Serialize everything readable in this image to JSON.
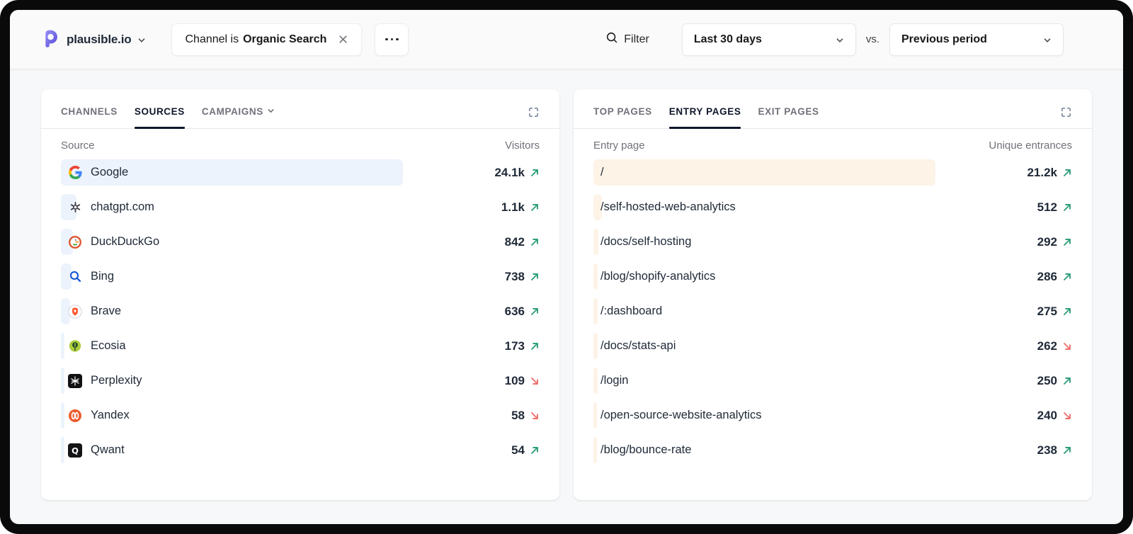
{
  "header": {
    "site_name": "plausible.io",
    "filter_chip": {
      "prefix": "Channel is",
      "value": "Organic Search"
    },
    "filter_label": "Filter",
    "date_range": "Last 30 days",
    "vs_label": "vs.",
    "comparison": "Previous period"
  },
  "colors": {
    "trend_up": "#2f9e7c",
    "trend_down": "#ef6f6a",
    "logo_accent": "#6e62ee",
    "active_tab": "#0f172a"
  },
  "sources_panel": {
    "tabs": [
      {
        "label": "CHANNELS",
        "active": false,
        "has_dropdown": false
      },
      {
        "label": "SOURCES",
        "active": true,
        "has_dropdown": false
      },
      {
        "label": "CAMPAIGNS",
        "active": false,
        "has_dropdown": true
      }
    ],
    "columns": {
      "label": "Source",
      "value": "Visitors"
    },
    "bar_color": "#edf3fc",
    "max_num": 24100,
    "rows": [
      {
        "icon": "google",
        "label": "Google",
        "value": "24.1k",
        "num": 24100,
        "trend": "up"
      },
      {
        "icon": "openai",
        "label": "chatgpt.com",
        "value": "1.1k",
        "num": 1100,
        "trend": "up"
      },
      {
        "icon": "duckduckgo",
        "label": "DuckDuckGo",
        "value": "842",
        "num": 842,
        "trend": "up"
      },
      {
        "icon": "bing",
        "label": "Bing",
        "value": "738",
        "num": 738,
        "trend": "up"
      },
      {
        "icon": "brave",
        "label": "Brave",
        "value": "636",
        "num": 636,
        "trend": "up"
      },
      {
        "icon": "ecosia",
        "label": "Ecosia",
        "value": "173",
        "num": 173,
        "trend": "up"
      },
      {
        "icon": "perplexity",
        "label": "Perplexity",
        "value": "109",
        "num": 109,
        "trend": "down"
      },
      {
        "icon": "yandex",
        "label": "Yandex",
        "value": "58",
        "num": 58,
        "trend": "down"
      },
      {
        "icon": "qwant",
        "label": "Qwant",
        "value": "54",
        "num": 54,
        "trend": "up"
      }
    ]
  },
  "pages_panel": {
    "tabs": [
      {
        "label": "TOP PAGES",
        "active": false,
        "has_dropdown": false
      },
      {
        "label": "ENTRY PAGES",
        "active": true,
        "has_dropdown": false
      },
      {
        "label": "EXIT PAGES",
        "active": false,
        "has_dropdown": false
      }
    ],
    "columns": {
      "label": "Entry page",
      "value": "Unique entrances"
    },
    "bar_color": "#fdf3e7",
    "max_num": 21200,
    "rows": [
      {
        "label": "/",
        "value": "21.2k",
        "num": 21200,
        "trend": "up"
      },
      {
        "label": "/self-hosted-web-analytics",
        "value": "512",
        "num": 512,
        "trend": "up"
      },
      {
        "label": "/docs/self-hosting",
        "value": "292",
        "num": 292,
        "trend": "up"
      },
      {
        "label": "/blog/shopify-analytics",
        "value": "286",
        "num": 286,
        "trend": "up"
      },
      {
        "label": "/:dashboard",
        "value": "275",
        "num": 275,
        "trend": "up"
      },
      {
        "label": "/docs/stats-api",
        "value": "262",
        "num": 262,
        "trend": "down"
      },
      {
        "label": "/login",
        "value": "250",
        "num": 250,
        "trend": "up"
      },
      {
        "label": "/open-source-website-analytics",
        "value": "240",
        "num": 240,
        "trend": "down"
      },
      {
        "label": "/blog/bounce-rate",
        "value": "238",
        "num": 238,
        "trend": "up"
      }
    ]
  },
  "icons": [
    "plausible-logo",
    "chevron-down",
    "search",
    "close",
    "ellipsis",
    "expand",
    "google",
    "openai",
    "duckduckgo",
    "bing",
    "brave",
    "ecosia",
    "perplexity",
    "yandex",
    "qwant",
    "trend-up-arrow",
    "trend-down-arrow"
  ]
}
